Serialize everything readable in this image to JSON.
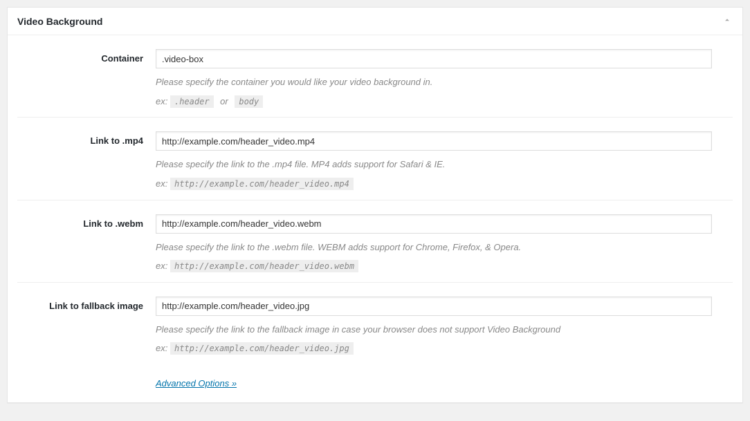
{
  "panel": {
    "title": "Video Background"
  },
  "fields": {
    "container": {
      "label": "Container",
      "value": ".video-box",
      "help": "Please specify the container you would like your video background in.",
      "ex_prefix": "ex:",
      "ex_code1": ".header",
      "ex_or": "or",
      "ex_code2": "body"
    },
    "mp4": {
      "label": "Link to .mp4",
      "value": "http://example.com/header_video.mp4",
      "help": "Please specify the link to the .mp4 file. MP4 adds support for Safari & IE.",
      "ex_prefix": "ex:",
      "ex_code": "http://example.com/header_video.mp4"
    },
    "webm": {
      "label": "Link to .webm",
      "value": "http://example.com/header_video.webm",
      "help": "Please specify the link to the .webm file. WEBM adds support for Chrome, Firefox, & Opera.",
      "ex_prefix": "ex:",
      "ex_code": "http://example.com/header_video.webm"
    },
    "fallback": {
      "label": "Link to fallback image",
      "value": "http://example.com/header_video.jpg",
      "help": "Please specify the link to the fallback image in case your browser does not support Video Background",
      "ex_prefix": "ex:",
      "ex_code": "http://example.com/header_video.jpg"
    }
  },
  "advanced_link": "Advanced Options »"
}
